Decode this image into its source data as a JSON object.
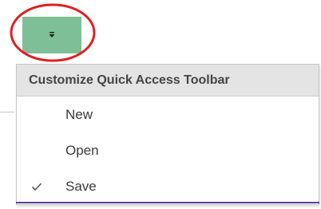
{
  "qat": {
    "button_icon": "customize-dropdown-icon",
    "button_color": "#7fbf97",
    "highlight_color": "#e02020"
  },
  "menu": {
    "header": "Customize Quick Access Toolbar",
    "items": [
      {
        "label": "New",
        "checked": false
      },
      {
        "label": "Open",
        "checked": false
      },
      {
        "label": "Save",
        "checked": true
      }
    ],
    "check_icon": "checkmark-icon",
    "accent_color": "#5a3f88"
  }
}
